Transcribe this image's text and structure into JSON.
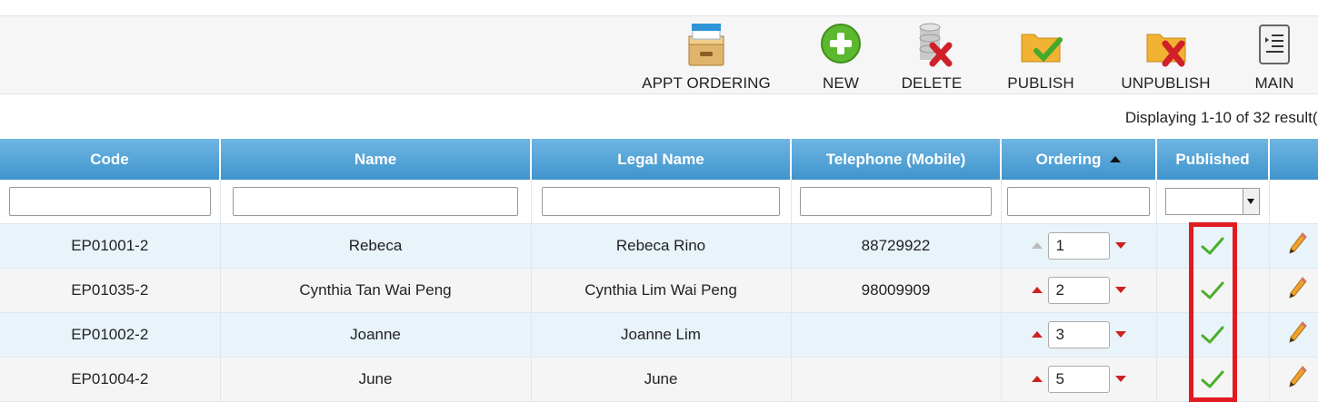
{
  "toolbar": {
    "buttons": [
      {
        "label": "APPT ORDERING",
        "icon": "file-cabinet-icon"
      },
      {
        "label": "NEW",
        "icon": "plus-circle-icon"
      },
      {
        "label": "DELETE",
        "icon": "database-delete-icon"
      },
      {
        "label": "PUBLISH",
        "icon": "folder-check-icon"
      },
      {
        "label": "UNPUBLISH",
        "icon": "folder-x-icon"
      },
      {
        "label": "MAIN",
        "icon": "list-menu-icon"
      }
    ]
  },
  "results_text": "Displaying 1-10 of 32 result(s",
  "table": {
    "columns": [
      "Code",
      "Name",
      "Legal Name",
      "Telephone (Mobile)",
      "Ordering",
      "Published",
      ""
    ],
    "sorted_column": "Ordering",
    "sort_direction": "ascending",
    "rows": [
      {
        "code": "EP01001-2",
        "name": "Rebeca",
        "legal_name": "Rebeca Rino",
        "telephone": "88729922",
        "ordering": "1",
        "published": true
      },
      {
        "code": "EP01035-2",
        "name": "Cynthia Tan Wai Peng",
        "legal_name": "Cynthia Lim Wai Peng",
        "telephone": "98009909",
        "ordering": "2",
        "published": true
      },
      {
        "code": "EP01002-2",
        "name": "Joanne",
        "legal_name": "Joanne Lim",
        "telephone": "",
        "ordering": "3",
        "published": true
      },
      {
        "code": "EP01004-2",
        "name": "June",
        "legal_name": "June",
        "telephone": "",
        "ordering": "5",
        "published": true
      }
    ]
  },
  "colors": {
    "header_gradient_top": "#6fb6e2",
    "header_gradient_bottom": "#3f94cd",
    "row_odd": "#e8f3fa",
    "row_even": "#f5f5f5",
    "highlight_box": "#e11b22",
    "check_green": "#4caf2a",
    "arrow_red": "#cc2222"
  }
}
